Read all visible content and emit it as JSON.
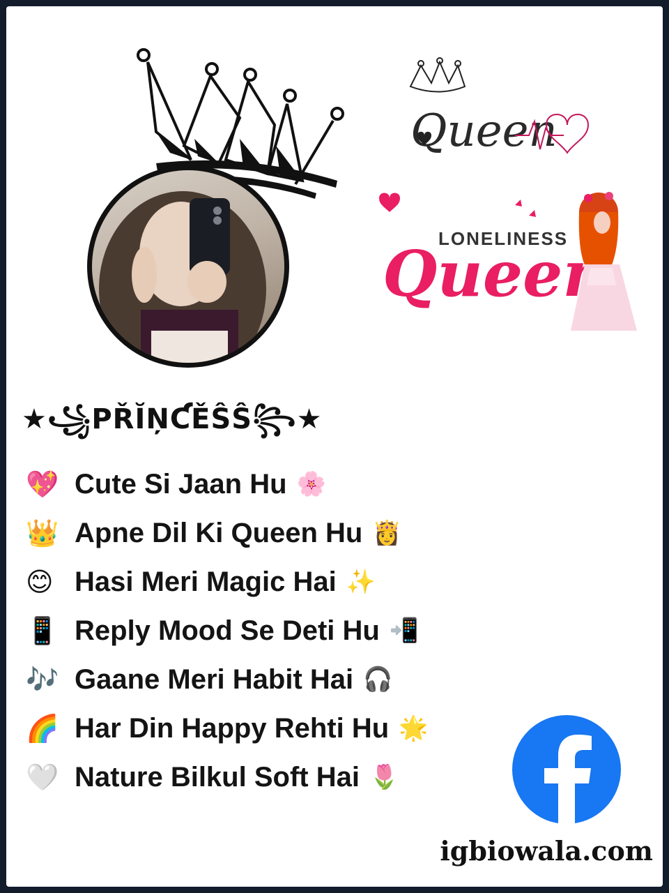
{
  "title": "★꧁PŘĬŅƇĚŜŜ꧂★",
  "logos": {
    "queen_small": "Queen",
    "loneliness_word": "LONELINESS",
    "loneliness_queen": "Queen"
  },
  "bio_lines": [
    {
      "emoji": "💖",
      "text": "Cute Si Jaan Hu",
      "end": "🌸"
    },
    {
      "emoji": "👑",
      "text": "Apne Dil Ki Queen Hu",
      "end": "👸"
    },
    {
      "emoji": "😊",
      "text": "Hasi Meri Magic Hai",
      "end": "✨"
    },
    {
      "emoji": "📱",
      "text": "Reply Mood Se Deti Hu",
      "end": "📲"
    },
    {
      "emoji": "🎶",
      "text": "Gaane Meri Habit Hai",
      "end": "🎧"
    },
    {
      "emoji": "🌈",
      "text": "Har Din Happy Rehti Hu",
      "end": "🌟"
    },
    {
      "emoji": "🤍",
      "text": "Nature Bilkul Soft Hai",
      "end": "🌷"
    }
  ],
  "watermark": "igbiowala.com",
  "colors": {
    "frame": "#121c2b",
    "accent_pink": "#d81b60",
    "facebook_blue": "#1877f2"
  },
  "icons": [
    "crown-icon",
    "facebook-icon"
  ]
}
